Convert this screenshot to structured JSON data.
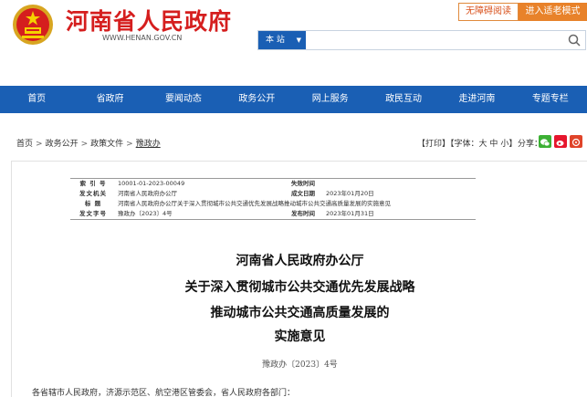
{
  "header": {
    "site_name": "河南省人民政府",
    "site_url": "WWW.HENAN.GOV.CN",
    "accessible_label": "无障碍阅读",
    "elderly_label": "进入适老模式",
    "search_scope": "本 站",
    "search_placeholder": ""
  },
  "nav": {
    "items": [
      "首页",
      "省政府",
      "要闻动态",
      "政务公开",
      "网上服务",
      "政民互动",
      "走进河南",
      "专题专栏"
    ]
  },
  "breadcrumb": {
    "items": [
      "首页",
      "政务公开",
      "政策文件",
      "豫政办"
    ],
    "separator": ">"
  },
  "tools": {
    "print": "【打印】",
    "font_prefix": "【字体：",
    "font_large": "大",
    "font_medium": "中",
    "font_small": "小",
    "font_suffix": "】",
    "share_label": "分享："
  },
  "meta": {
    "rows": [
      {
        "k1": "索 引 号",
        "v1": "10001-01-2023-00049",
        "k2": "失效时间",
        "v2": ""
      },
      {
        "k1": "发文机关",
        "v1": "河南省人民政府办公厅",
        "k2": "成文日期",
        "v2": "2023年01月20日"
      },
      {
        "k1": "标 题",
        "v1": "河南省人民政府办公厅关于深入贯彻城市公共交通优先发展战略推动城市公共交通高质量发展的实施意见",
        "k2": "",
        "v2": ""
      },
      {
        "k1": "发文字号",
        "v1": "豫政办〔2023〕4号",
        "k2": "发布时间",
        "v2": "2023年01月31日"
      }
    ]
  },
  "doc": {
    "title_lines": [
      "河南省人民政府办公厅",
      "关于深入贯彻城市公共交通优先发展战略",
      "推动城市公共交通高质量发展的",
      "实施意见"
    ],
    "number": "豫政办〔2023〕4号",
    "salutation": "各省辖市人民政府，济源示范区、航空港区管委会，省人民政府各部门："
  }
}
